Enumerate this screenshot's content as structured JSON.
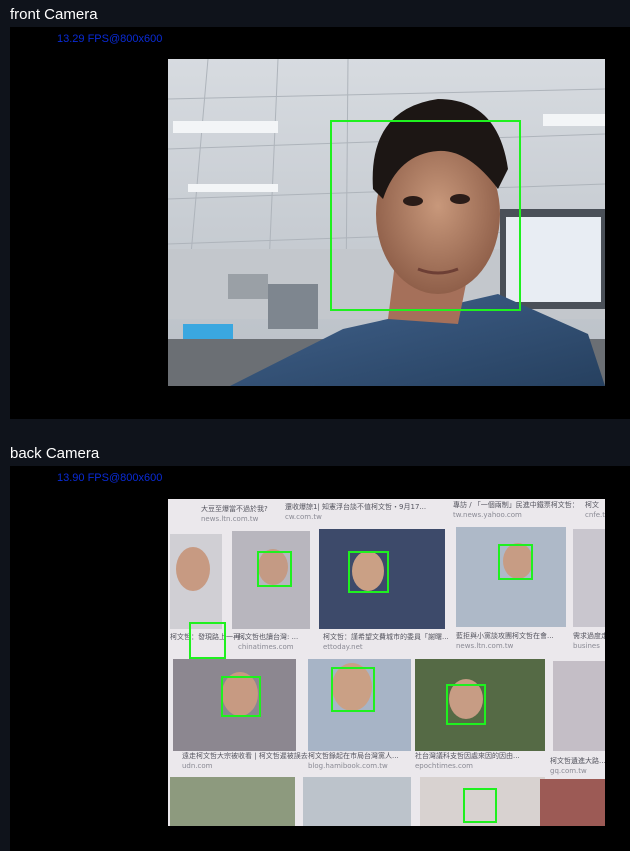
{
  "front": {
    "title": "front Camera",
    "fps": "13.29 FPS@800x600",
    "faces_detected": 1
  },
  "back": {
    "title": "back Camera",
    "fps": "13.90 FPS@800x600",
    "faces_detected": 8,
    "visible_text": [
      "大豆至爆當不過於我?",
      "news.ltn.com.tw",
      "還收爆諒1| 知憲浮台談不值柯文哲・9月17...",
      "cw.com.tw",
      "專訪 / 「一個兩制」民進中鐵票柯文哲：",
      "tw.news.yahoo.com",
      "柯文",
      "cnfe.tw",
      "柯文哲也讀台灣: ...",
      "chinatimes.com",
      "柯文哲：謹希望文費城市的委員「謝曙...",
      "ettoday.net",
      "藍拒與小黨談攻團柯文哲在會...",
      "news.ltn.com.tw",
      "需求過度走",
      "busines",
      "柯文哲：發現路上一再...",
      "遠走柯文哲大宗被收看 | 柯文哲遲被誤去",
      "udn.com",
      "柯文哲錄起在市局台灣黨人...",
      "blog.hamibook.com.tw",
      "社台灣議科支哲因處來因的因由...",
      "epochtimes.com",
      "柯文哲遺進大路...",
      "gq.com.tw"
    ]
  },
  "colors": {
    "page_bg": "#0f131b",
    "panel_bg": "#000000",
    "title_text": "#ffffff",
    "fps_text": "#0a2bd6",
    "face_box": "#1ff01f"
  }
}
